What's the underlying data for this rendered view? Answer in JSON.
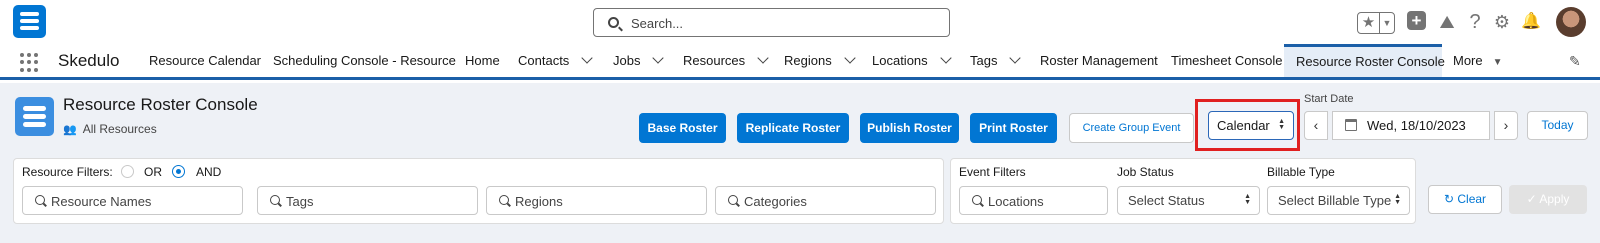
{
  "header": {
    "search_placeholder": "Search...",
    "icons": [
      "favorites-star-icon",
      "add-icon",
      "trailhead-icon",
      "help-icon",
      "setup-gear-icon",
      "notifications-bell-icon",
      "user-avatar"
    ]
  },
  "nav": {
    "app_name": "Skedulo",
    "items": [
      {
        "label": "Resource Calendar"
      },
      {
        "label": "Scheduling Console - Resource"
      },
      {
        "label": "Home"
      },
      {
        "label": "Contacts"
      },
      {
        "label": "Jobs"
      },
      {
        "label": "Resources"
      },
      {
        "label": "Regions"
      },
      {
        "label": "Locations"
      },
      {
        "label": "Tags"
      },
      {
        "label": "Roster Management"
      },
      {
        "label": "Timesheet Console"
      },
      {
        "label": "Resource Roster Console"
      },
      {
        "label": "More"
      }
    ],
    "active": "Resource Roster Console"
  },
  "page": {
    "title": "Resource Roster Console",
    "subtitle": "All Resources",
    "buttons": {
      "base_roster": "Base Roster",
      "replicate_roster": "Replicate Roster",
      "publish_roster": "Publish Roster",
      "print_roster": "Print Roster",
      "create_group_event": "Create Group Event",
      "today": "Today"
    },
    "view_select": "Calendar",
    "start_date_label": "Start Date",
    "start_date": "Wed, 18/10/2023"
  },
  "filters": {
    "resource_filters_label": "Resource Filters:",
    "or_label": "OR",
    "and_label": "AND",
    "selected_logic": "AND",
    "resource_names_placeholder": "Resource Names",
    "tags_placeholder": "Tags",
    "regions_placeholder": "Regions",
    "categories_placeholder": "Categories",
    "event_filters_label": "Event Filters",
    "locations_placeholder": "Locations",
    "job_status_label": "Job Status",
    "job_status_value": "Select Status",
    "billable_type_label": "Billable Type",
    "billable_type_value": "Select Billable Type",
    "clear_label": "Clear",
    "apply_label": "Apply"
  },
  "colors": {
    "brand": "#0176d3",
    "nav_active_bar": "#1b5fa8",
    "highlight": "#e02020"
  }
}
